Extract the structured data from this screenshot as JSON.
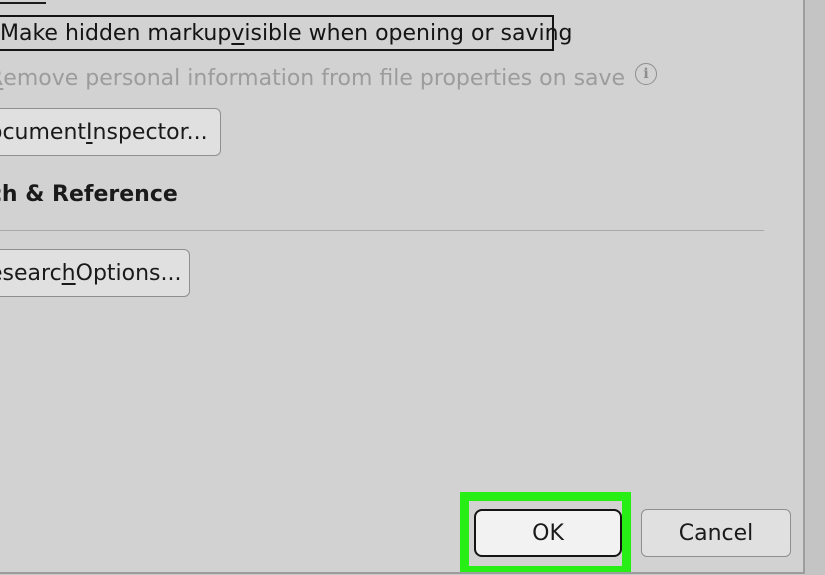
{
  "privacy": {
    "markup_label_pre": "Make hidden markup ",
    "markup_label_key": "v",
    "markup_label_post": "isible when opening or saving",
    "personal_label_key": "R",
    "personal_label_rest": "emove personal information from file properties on save",
    "info_icon_glyph": "i",
    "inspector_pre": "ocument ",
    "inspector_key": "I",
    "inspector_post": "nspector..."
  },
  "research": {
    "section_title": "rch & Reference",
    "options_pre": "esearc",
    "options_key": "h",
    "options_post": " Options..."
  },
  "footer": {
    "ok_label": "OK",
    "cancel_label": "Cancel"
  },
  "colors": {
    "highlight": "#27ee14",
    "dialog_bg": "#d2d2d2",
    "disabled_text": "#9c9c9c"
  }
}
